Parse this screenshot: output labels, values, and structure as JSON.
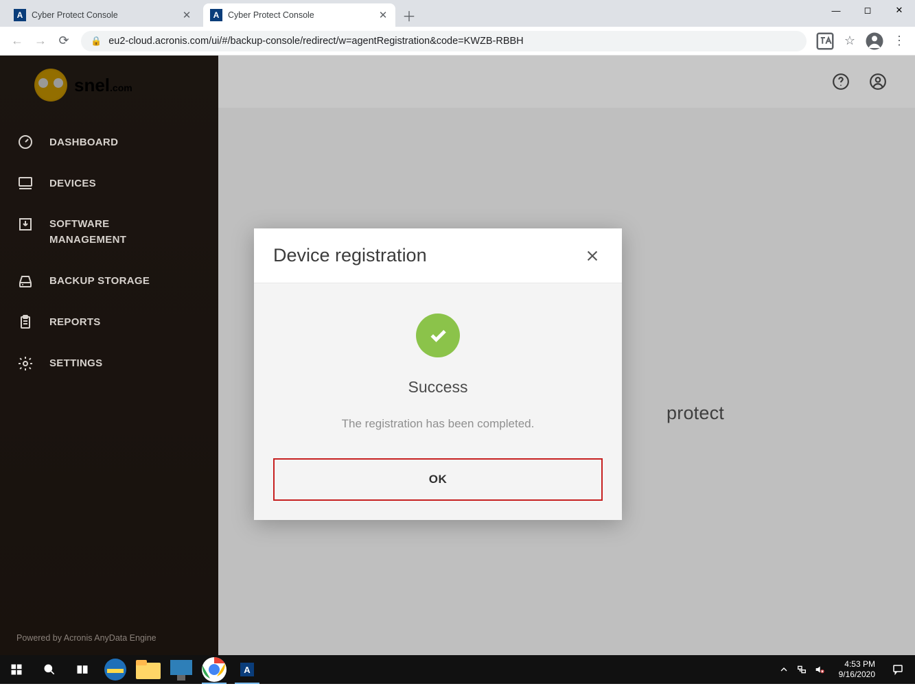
{
  "browser": {
    "tabs": [
      {
        "title": "Cyber Protect Console",
        "active": false
      },
      {
        "title": "Cyber Protect Console",
        "active": true
      }
    ],
    "url": "eu2-cloud.acronis.com/ui/#/backup-console/redirect/w=agentRegistration&code=KWZB-RBBH"
  },
  "logo": {
    "brand": "snel",
    "suffix": ".com"
  },
  "sidebar": {
    "items": [
      {
        "label": "DASHBOARD"
      },
      {
        "label": "DEVICES"
      },
      {
        "label_line1": "SOFTWARE",
        "label_line2": "MANAGEMENT"
      },
      {
        "label": "BACKUP STORAGE"
      },
      {
        "label": "REPORTS"
      },
      {
        "label": "SETTINGS"
      }
    ],
    "footer": "Powered by Acronis AnyData Engine"
  },
  "background_word": "protect",
  "modal": {
    "title": "Device registration",
    "status_title": "Success",
    "message": "The registration has been completed.",
    "ok_label": "OK"
  },
  "taskbar": {
    "time": "4:53 PM",
    "date": "9/16/2020"
  }
}
